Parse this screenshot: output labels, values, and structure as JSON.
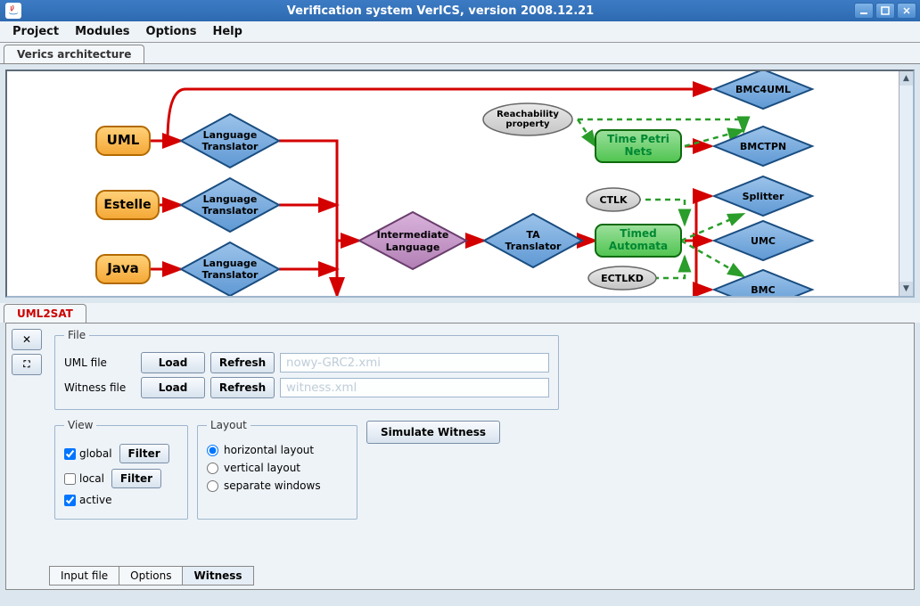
{
  "window": {
    "title": "Verification system VerICS, version 2008.12.21"
  },
  "menu": {
    "project": "Project",
    "modules": "Modules",
    "options": "Options",
    "help": "Help"
  },
  "top_tab": {
    "label": "Verics architecture"
  },
  "diagram": {
    "nodes": {
      "uml": "UML",
      "estelle": "Estelle",
      "java": "Java",
      "lang_trans": "Language\nTranslator",
      "intermediate": "Intermediate\nLanguage",
      "ta_trans": "TA\nTranslator",
      "reachability": "Reachability\nproperty",
      "ctlk": "CTLK",
      "ectlkd": "ECTLKD",
      "time_petri": "Time Petri\nNets",
      "timed_automata": "Timed\nAutomata",
      "bmc4uml": "BMC4UML",
      "bmctpn": "BMCTPN",
      "splitter": "Splitter",
      "umc": "UMC",
      "bmc": "BMC"
    }
  },
  "bottom_tab": {
    "label": "UML2SAT"
  },
  "file_group": {
    "legend": "File",
    "uml_label": "UML file",
    "witness_label": "Witness file",
    "load": "Load",
    "refresh": "Refresh",
    "uml_value": "nowy-GRC2.xmi",
    "witness_value": "witness.xml"
  },
  "view_group": {
    "legend": "View",
    "global": "global",
    "local": "local",
    "active": "active",
    "filter": "Filter"
  },
  "layout_group": {
    "legend": "Layout",
    "horizontal": "horizontal layout",
    "vertical": "vertical layout",
    "separate": "separate windows"
  },
  "simulate": "Simulate Witness",
  "sub_tabs": {
    "input": "Input file",
    "options": "Options",
    "witness": "Witness"
  },
  "close_glyph": "✕",
  "expand_glyph": "⛶"
}
